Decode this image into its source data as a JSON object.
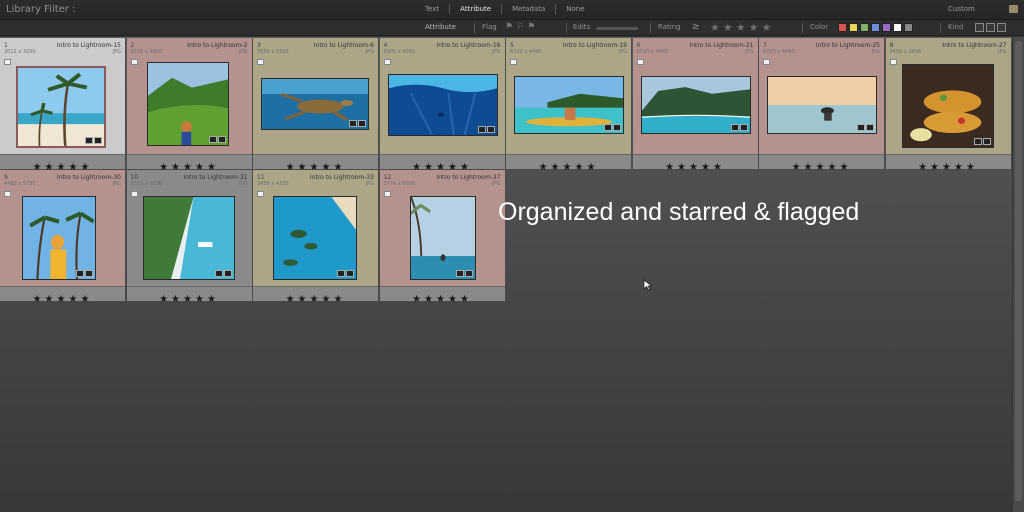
{
  "filter_bar": {
    "title": "Library Filter :",
    "tabs": [
      "Text",
      "Attribute",
      "Metadata",
      "None"
    ],
    "active_tab": "Attribute",
    "preset": "Custom"
  },
  "attribute_bar": {
    "label": "Attribute",
    "flag_label": "Flag",
    "edits_label": "Edits",
    "rating_label": "Rating",
    "rating_operator": "≥",
    "rating_stars": "★★★★★",
    "color_label": "Color",
    "color_swatches": [
      "#d9534f",
      "#e8d45a",
      "#7fb36a",
      "#6a8fd8",
      "#9b6bc6",
      "#ffffff",
      "#888888"
    ],
    "kind_label": "Kind"
  },
  "grid": {
    "cells": [
      {
        "index": "1",
        "name": "Intro to Lightroom-15",
        "dims": "2012 x 3200",
        "type": "JPG",
        "label_color": "white",
        "rating": 5,
        "stars": "★★★★★",
        "thumb": "beach-palm"
      },
      {
        "index": "2",
        "name": "Intro to Lightroom-2",
        "dims": "3728 x 4660",
        "type": "JPG",
        "label_color": "red",
        "rating": 5,
        "stars": "★★★★★",
        "thumb": "jungle-girl"
      },
      {
        "index": "3",
        "name": "Intro to Lightroom-6",
        "dims": "7950 x 5300",
        "type": "JPG",
        "label_color": "yellow",
        "rating": 5,
        "stars": "★★★★★",
        "thumb": "sea-turtle"
      },
      {
        "index": "4",
        "name": "Intro to Lightroom-16",
        "dims": "6000 x 4000",
        "type": "JPG",
        "label_color": "yellow",
        "rating": 5,
        "stars": "★★★★★",
        "thumb": "underwater"
      },
      {
        "index": "5",
        "name": "Intro to Lightroom-19",
        "dims": "6720 x 4480",
        "type": "JPG",
        "label_color": "yellow",
        "rating": 5,
        "stars": "★★★★★",
        "thumb": "kayak"
      },
      {
        "index": "6",
        "name": "Intro to Lightroom-21",
        "dims": "6720 x 4480",
        "type": "JPG",
        "label_color": "red",
        "rating": 5,
        "stars": "★★★★★",
        "thumb": "coast-cliffs"
      },
      {
        "index": "7",
        "name": "Intro to Lightroom-25",
        "dims": "6720 x 4480",
        "type": "JPG",
        "label_color": "red",
        "rating": 5,
        "stars": "★★★★★",
        "thumb": "sunset-swimmer"
      },
      {
        "index": "8",
        "name": "Intro to Lightroom-27",
        "dims": "3456 x 3456",
        "type": "JPG",
        "label_color": "yellow",
        "rating": 5,
        "stars": "★★★★★",
        "thumb": "tacos"
      },
      {
        "index": "9",
        "name": "Intro to Lightroom-30",
        "dims": "4480 x 5730",
        "type": "JPG",
        "label_color": "red",
        "rating": 5,
        "stars": "★★★★★",
        "thumb": "palm-girl"
      },
      {
        "index": "10",
        "name": "Intro to Lightroom-31",
        "dims": "2567 x 3606",
        "type": "JPG",
        "label_color": "gray",
        "rating": 5,
        "stars": "★★★★★",
        "thumb": "aerial-beach"
      },
      {
        "index": "11",
        "name": "Intro to Lightroom-33",
        "dims": "3456 x 4320",
        "type": "JPG",
        "label_color": "yellow",
        "rating": 5,
        "stars": "★★★★★",
        "thumb": "lagoon"
      },
      {
        "index": "12",
        "name": "Intro to Lightroom-37",
        "dims": "3774 x 6000",
        "type": "JPG",
        "label_color": "red",
        "rating": 5,
        "stars": "★★★★★",
        "thumb": "infinity-pool"
      }
    ]
  },
  "caption": "Organized and starred & flagged"
}
